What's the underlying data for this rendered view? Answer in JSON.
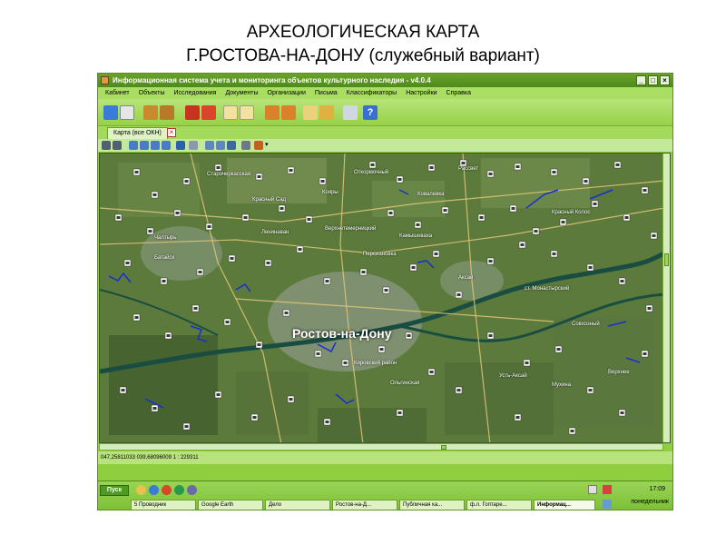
{
  "slide": {
    "title_line1": "АРХЕОЛОГИЧЕСКАЯ КАРТА",
    "title_line2": "Г.РОСТОВА-НА-ДОНУ (служебный вариант)"
  },
  "window": {
    "title": "Информационная система учета и мониторинга объектов культурного наследия - v4.0.4",
    "min_label": "_",
    "max_label": "□",
    "close_label": "×"
  },
  "menu": [
    "Кабинет",
    "Объекты",
    "Исследования",
    "Документы",
    "Организации",
    "Письма",
    "Классификаторы",
    "Настройки",
    "Справка"
  ],
  "tab": {
    "label": "Карта (все ОКН)",
    "close_label": "×"
  },
  "map": {
    "labels": {
      "city": "Ростов-на-Дону",
      "aksay": "Аксай",
      "bataysk": "Батайск",
      "chaltyr": "Чалтырь",
      "verkhnetemernitsky": "Верхнетемерницкий",
      "otkormochny": "Откормочный",
      "kovalevka": "Ковалевка",
      "koyarly": "Кояры",
      "rassvet": "Рассвет",
      "olginskaya": "Ольгинская",
      "starocherkasskaya": "Старочеркасская",
      "sovkhozny": "Совхозный",
      "mukhina": "Мухина",
      "krasny_sad": "Красный Сад",
      "kamyshevaha": "Камышеваха",
      "krasny_kolos": "Красный Колос",
      "leninavan": "Ленинаван",
      "verkhnee": "Верхнее",
      "ust_aksay": "Усть-Аксай",
      "l_monastyrsky": "ст. Монастырский",
      "persian": "Персиановка",
      "kirovsky": "Кировский район"
    },
    "colors": {
      "field": "#5b7a3b",
      "river": "#1a4d42",
      "road": "#e2c87a",
      "urban": "#9aa39a"
    }
  },
  "status": {
    "coordinates": "047,25811033   039,68096009   1 : 229311"
  },
  "taskbar": {
    "start": "Пуск",
    "tasks": [
      "5 Проводник",
      "Google Earth",
      "Дело",
      "Ростов-на-Д...",
      "Публичная ка...",
      "ф.л. Гоптаре...",
      "Информац..."
    ],
    "time": "17:09",
    "day": "понедельник"
  }
}
